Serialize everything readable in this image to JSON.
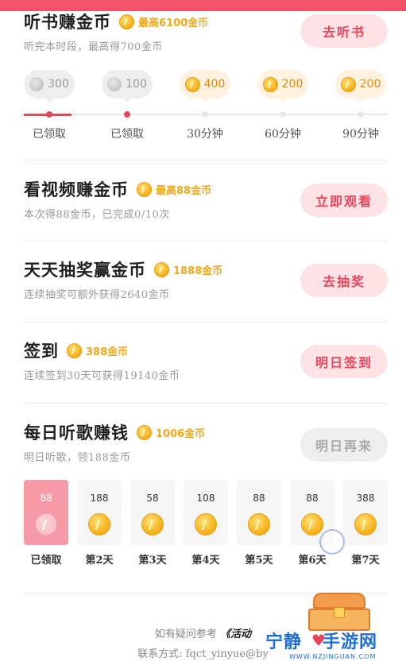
{
  "listen": {
    "title": "听书赚金币",
    "reward": "最高6100金币",
    "subtitle": "听完本时段，最高得700金币",
    "button": "去听书",
    "bubbles": [
      "300",
      "100",
      "400",
      "200",
      "200"
    ],
    "steps": [
      "已领取",
      "已领取",
      "30分钟",
      "60分钟",
      "90分钟"
    ]
  },
  "video": {
    "title": "看视频赚金币",
    "reward": "最高88金币",
    "subtitle": "本次得88金币，已完成0/10次",
    "button": "立即观看"
  },
  "lottery": {
    "title": "天天抽奖赢金币",
    "reward": "1888金币",
    "subtitle": "连续抽奖可额外获得2640金币",
    "button": "去抽奖"
  },
  "checkin": {
    "title": "签到",
    "reward": "388金币",
    "subtitle": "连续签到30天可获得19140金币",
    "button": "明日签到"
  },
  "song": {
    "title": "每日听歌赚钱",
    "reward": "1006金币",
    "subtitle": "明日听歌，领188金币",
    "button": "明日再来",
    "days": [
      {
        "value": "88",
        "label": "已领取"
      },
      {
        "value": "188",
        "label": "第2天"
      },
      {
        "value": "58",
        "label": "第3天"
      },
      {
        "value": "108",
        "label": "第4天"
      },
      {
        "value": "88",
        "label": "第5天"
      },
      {
        "value": "88",
        "label": "第6天"
      },
      {
        "value": "388",
        "label": "第7天"
      }
    ]
  },
  "footer": {
    "line1_prefix": "如有疑问参考",
    "line1_link": "《活动",
    "line2": "联系方式:  fqct_yinyue@by"
  },
  "watermark": {
    "name_a": "宁静",
    "name_b": "手游网",
    "url": "WWW.NZJINGUAN.COM"
  },
  "colors": {
    "accent": "#e9455a",
    "button_bg": "#fde2e6",
    "gold": "#f0a91a",
    "claimed_day": "#f69aa7"
  }
}
